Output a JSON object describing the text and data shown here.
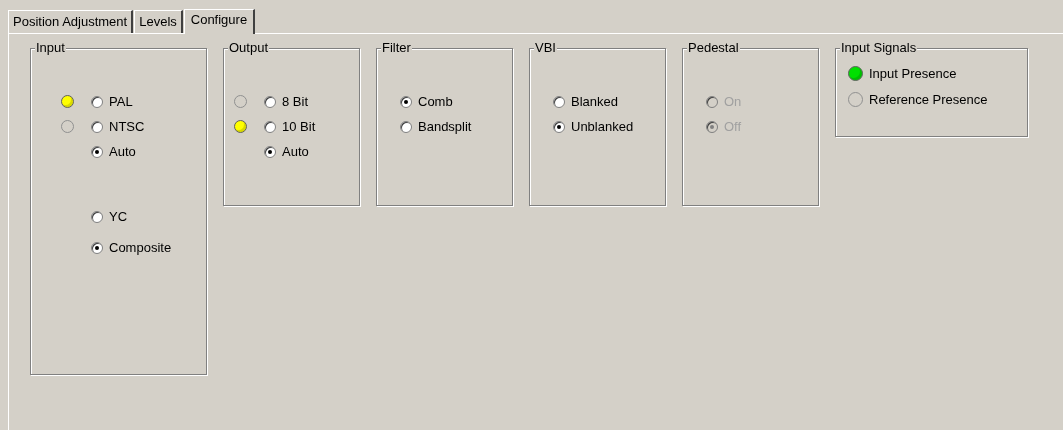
{
  "tabs": [
    {
      "label": "Position Adjustment",
      "selected": false
    },
    {
      "label": "Levels",
      "selected": false
    },
    {
      "label": "Configure",
      "selected": true
    }
  ],
  "groups": [
    {
      "title": "Input",
      "disabled": false,
      "sections": [
        [
          {
            "label": "PAL",
            "selected": false,
            "lamp": {
              "on": true,
              "color": "#ffff00"
            }
          },
          {
            "label": "NTSC",
            "selected": false,
            "lamp": {
              "on": false
            }
          },
          {
            "label": "Auto",
            "selected": true
          }
        ],
        [
          {
            "label": "YC",
            "selected": false
          },
          {
            "label": "Composite",
            "selected": true
          }
        ]
      ]
    },
    {
      "title": "Output",
      "disabled": false,
      "sections": [
        [
          {
            "label": "8 Bit",
            "selected": false,
            "lamp": {
              "on": false
            }
          },
          {
            "label": "10 Bit",
            "selected": false,
            "lamp": {
              "on": true,
              "color": "#ffff00"
            }
          },
          {
            "label": "Auto",
            "selected": true
          }
        ]
      ]
    },
    {
      "title": "Filter",
      "disabled": false,
      "sections": [
        [
          {
            "label": "Comb",
            "selected": true
          },
          {
            "label": "Bandsplit",
            "selected": false
          }
        ]
      ]
    },
    {
      "title": "VBI",
      "disabled": false,
      "sections": [
        [
          {
            "label": "Blanked",
            "selected": false
          },
          {
            "label": "Unblanked",
            "selected": true
          }
        ]
      ]
    },
    {
      "title": "Pedestal",
      "disabled": true,
      "sections": [
        [
          {
            "label": "On",
            "selected": false
          },
          {
            "label": "Off",
            "selected": true
          }
        ]
      ]
    }
  ],
  "input_signals": {
    "title": "Input Signals",
    "items": [
      {
        "label": "Input Presence",
        "on": true,
        "color": "#00e000"
      },
      {
        "label": "Reference Presence",
        "on": false
      }
    ]
  }
}
